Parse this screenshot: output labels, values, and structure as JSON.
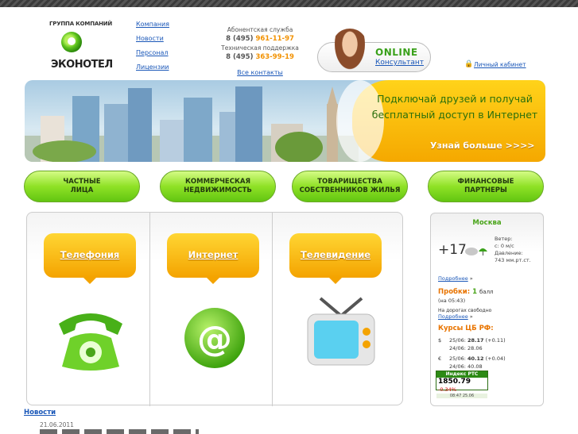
{
  "header": {
    "group_label": "ГРУППА КОМПАНИЙ",
    "logo_name": "ЭКОНОТЕЛ",
    "nav_links": [
      "Компания",
      "Новости",
      "Персонал",
      "Лицензии"
    ],
    "subscriber_service_label": "Абонентская служба",
    "subscriber_code": "8 (495)",
    "subscriber_number": "961-11-97",
    "tech_support_label": "Техническая поддержка",
    "tech_code": "8 (495)",
    "tech_number": "363-99-19",
    "all_contacts": "Все контакты",
    "online_title": "ONLINE",
    "online_subtitle": "Консультант",
    "cabinet_link": "Личный кабинет"
  },
  "banner": {
    "promo_line1": "Подключай друзей и получай",
    "promo_line2": "бесплатный доступ в Интернет",
    "more_link": "Узнай больше >>>>"
  },
  "categories": [
    {
      "line1": "ЧАСТНЫЕ",
      "line2": "ЛИЦА"
    },
    {
      "line1": "КОММЕРЧЕСКАЯ",
      "line2": "НЕДВИЖИМОСТЬ"
    },
    {
      "line1": "ТОВАРИЩЕСТВА",
      "line2": "СОБСТВЕННИКОВ ЖИЛЬЯ"
    },
    {
      "line1": "ФИНАНСОВЫЕ",
      "line2": "ПАРТНЕРЫ"
    }
  ],
  "services": [
    {
      "label": "Телефония",
      "icon": "telephone-icon"
    },
    {
      "label": "Интернет",
      "icon": "at-sign-icon"
    },
    {
      "label": "Телевидение",
      "icon": "tv-icon"
    }
  ],
  "sidebar": {
    "city": "Москва",
    "temperature": "+17",
    "weather_icon": "cloud-umbrella-icon",
    "wind_label": "Ветер:",
    "wind_value": "с: 0 м/с",
    "pressure_label": "Давление:",
    "pressure_value": "743 мм.рт.ст.",
    "details_link": "Подробнее",
    "traffic_label": "Пробки:",
    "traffic_score": "1",
    "traffic_unit": "балл",
    "traffic_time": "(на 05:43)",
    "traffic_status": "На дорогах свободно",
    "traffic_details_link": "Подробнее",
    "rates_title": "Курсы ЦБ РФ:",
    "usd_symbol": "$",
    "usd_date1": "25/06:",
    "usd_value1": "28.17",
    "usd_change": "(+0.11)",
    "usd_date2": "24/06:",
    "usd_value2": "28.06",
    "eur_symbol": "€",
    "eur_date1": "25/06:",
    "eur_value1": "40.12",
    "eur_change": "(+0.04)",
    "eur_date2": "24/06:",
    "eur_value2": "40.08",
    "rts_title": "Индекс РТС",
    "rts_value": "1850.79",
    "rts_change": "-0.34%",
    "rts_time": "08:47  25.06"
  },
  "news": {
    "title": "Новости",
    "date": "21.06.2011"
  },
  "colors": {
    "accent_green": "#62c511",
    "accent_orange": "#f4a300",
    "link_blue": "#1a57b8"
  }
}
